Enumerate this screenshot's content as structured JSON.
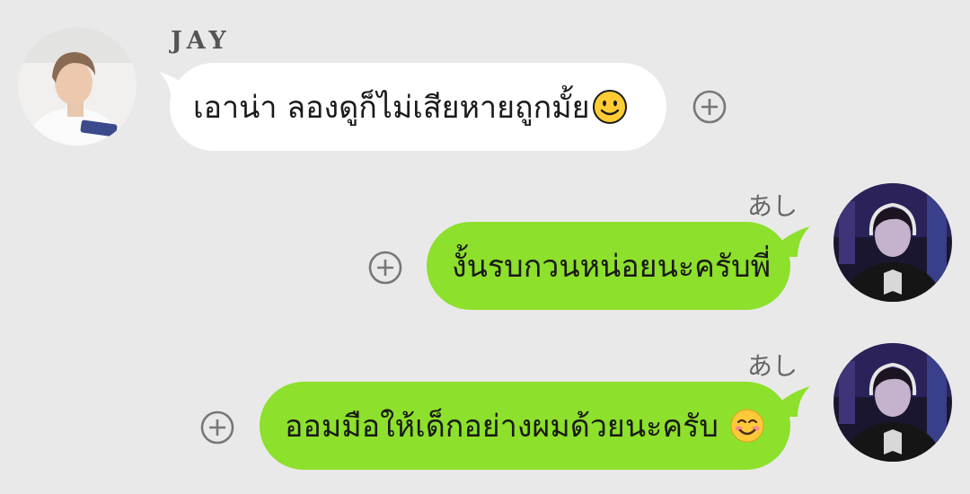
{
  "messages": [
    {
      "direction": "incoming",
      "sender_name": "JAY",
      "text": "เอาน่า ลองดูก็ไม่เสียหายถูกมั้ย",
      "emoji": "slightly-smiling-face-emoji",
      "avatar": "jay-avatar"
    },
    {
      "direction": "outgoing",
      "nickname": "あし",
      "text": "งั้นรบกวนหน่อยนะครับพี่",
      "avatar": "user-avatar"
    },
    {
      "direction": "outgoing",
      "nickname": "あし",
      "text": "ออมมือให้เด็กอย่างผมด้วยนะครับ",
      "emoji": "smiling-face-blush-emoji",
      "avatar": "user-avatar"
    }
  ],
  "icons": {
    "add": "plus-circle-icon"
  },
  "colors": {
    "background": "#e9e9e9",
    "incoming_bubble": "#ffffff",
    "outgoing_bubble": "#8de02b",
    "text": "#1a1a1a",
    "icon": "#777777"
  }
}
